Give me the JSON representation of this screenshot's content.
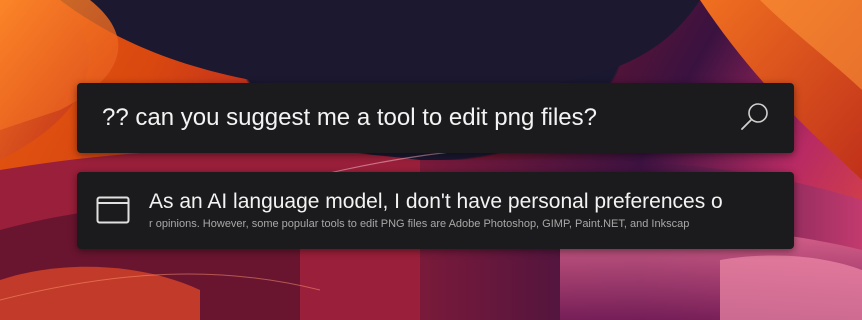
{
  "search": {
    "query": "?? can you suggest me a tool to edit png files?",
    "icon": "search-icon"
  },
  "result": {
    "icon": "window-icon",
    "title": "As an AI language model, I don't have personal preferences o",
    "subtitle": "r opinions. However, some popular tools to edit PNG files are Adobe Photoshop, GIMP, Paint.NET, and Inkscap"
  },
  "colors": {
    "panel": "#1b1b1d",
    "text_primary": "#f3f3f3",
    "text_secondary": "#a8a8a8"
  }
}
